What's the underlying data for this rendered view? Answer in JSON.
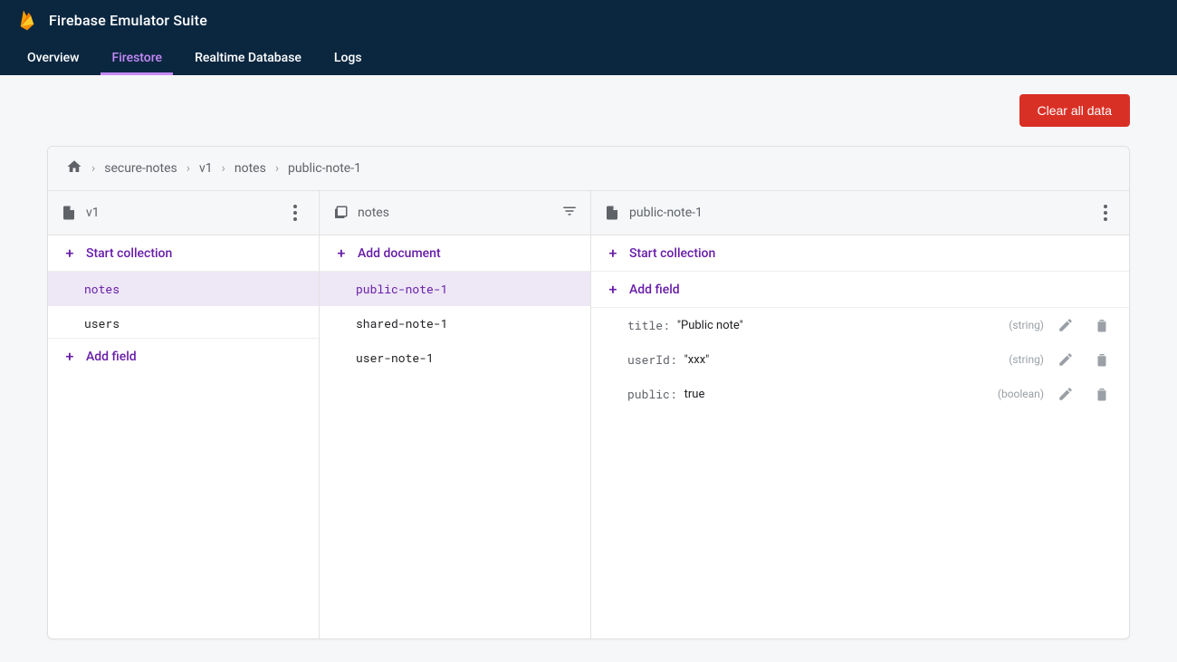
{
  "header": {
    "title": "Firebase Emulator Suite",
    "tabs": [
      {
        "label": "Overview",
        "active": false
      },
      {
        "label": "Firestore",
        "active": true
      },
      {
        "label": "Realtime Database",
        "active": false
      },
      {
        "label": "Logs",
        "active": false
      }
    ]
  },
  "actions": {
    "clear_all": "Clear all data"
  },
  "breadcrumb": [
    "secure-notes",
    "v1",
    "notes",
    "public-note-1"
  ],
  "columns": {
    "col1": {
      "title": "v1",
      "start_label": "Start collection",
      "add_field_label": "Add field",
      "items": [
        {
          "label": "notes",
          "selected": true
        },
        {
          "label": "users",
          "selected": false
        }
      ]
    },
    "col2": {
      "title": "notes",
      "start_label": "Add document",
      "items": [
        {
          "label": "public-note-1",
          "selected": true
        },
        {
          "label": "shared-note-1",
          "selected": false
        },
        {
          "label": "user-note-1",
          "selected": false
        }
      ]
    },
    "col3": {
      "title": "public-note-1",
      "start_label": "Start collection",
      "add_field_label": "Add field",
      "fields": [
        {
          "key": "title",
          "value": "\"Public note\"",
          "type": "(string)"
        },
        {
          "key": "userId",
          "value": "\"xxx\"",
          "type": "(string)"
        },
        {
          "key": "public",
          "value": "true",
          "type": "(boolean)"
        }
      ]
    }
  }
}
